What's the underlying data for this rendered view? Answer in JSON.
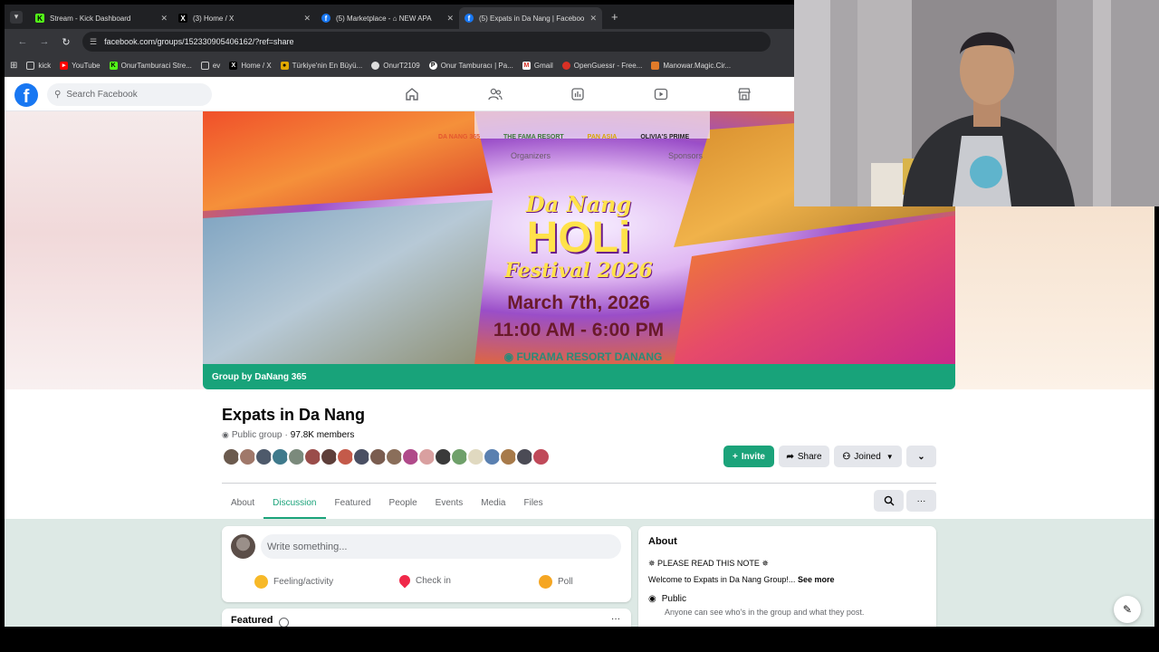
{
  "browser": {
    "tabs": [
      {
        "label": "Stream - Kick Dashboard",
        "active": false
      },
      {
        "label": "(3) Home / X",
        "active": false
      },
      {
        "label": "(5) Marketplace - ⌂ NEW APA",
        "active": false
      },
      {
        "label": "(5) Expats in Da Nang | Faceboo",
        "active": true
      }
    ],
    "new_tab": "+",
    "url": "facebook.com/groups/152330905406162/?ref=share",
    "bookmarks": [
      "kick",
      "YouTube",
      "OnurTamburaci Stre...",
      "ev",
      "Home / X",
      "Türkiye'nin En Büyü...",
      "OnurT2109",
      "Onur Tamburacı | Pa...",
      "Gmail",
      "OpenGuessr - Free...",
      "Manowar.Magic.Cir..."
    ]
  },
  "facebook": {
    "logo": "f",
    "search_placeholder": "Search Facebook",
    "nav_icons": [
      "home-icon",
      "friends-icon",
      "groups-feed-icon",
      "video-icon",
      "marketplace-icon"
    ]
  },
  "banner": {
    "sponsors": [
      "DA NANG 365",
      "THE FAMA RESORT",
      "PAN ASIA",
      "OLIVIA'S PRIME"
    ],
    "organizers_label": "Organizers",
    "sponsors_label": "Sponsors",
    "title_line1": "Da Nang",
    "title_line2": "HOLi",
    "title_line3": "Festival 2026",
    "date": "March 7th, 2026",
    "time": "11:00 AM - 6:00 PM",
    "venue": "FURAMA RESORT DANANG",
    "caption": "Group by DaNang 365"
  },
  "group": {
    "name": "Expats in Da Nang",
    "privacy": "Public group",
    "separator": "·",
    "members": "97.8K members",
    "avatar_colors": [
      "#6b5a4e",
      "#a0786a",
      "#4e5a6b",
      "#3f7a8c",
      "#7b8a7c",
      "#9a4d4a",
      "#5e3f3a",
      "#c45a4a",
      "#4a4f63",
      "#7a5d50",
      "#8a6e5a",
      "#b04a8a",
      "#d9a0a0",
      "#3a3a3a",
      "#6fa06a",
      "#e0d9c0",
      "#5a80b0",
      "#a77a4a",
      "#4b4b55",
      "#c04a5a"
    ],
    "buttons": {
      "invite": "Invite",
      "share": "Share",
      "joined": "Joined",
      "more": "⌄"
    },
    "tabs": [
      "About",
      "Discussion",
      "Featured",
      "People",
      "Events",
      "Media",
      "Files"
    ],
    "active_tab": "Discussion"
  },
  "composer": {
    "placeholder": "Write something...",
    "actions": [
      {
        "label": "Feeling/activity",
        "color": "#f7b928"
      },
      {
        "label": "Check in",
        "color": "#f02849"
      },
      {
        "label": "Poll",
        "color": "#f5a623"
      }
    ]
  },
  "featured": {
    "label": "Featured"
  },
  "about": {
    "heading": "About",
    "note": "✵ PLEASE READ THIS NOTE ✵",
    "welcome": "Welcome to Expats in Da Nang Group!...",
    "see_more": "See more",
    "public_title": "Public",
    "public_desc": "Anyone can see who's in the group and what they post."
  },
  "colors": {
    "facebook_blue": "#1877f2",
    "group_accent": "#1ba37a"
  }
}
